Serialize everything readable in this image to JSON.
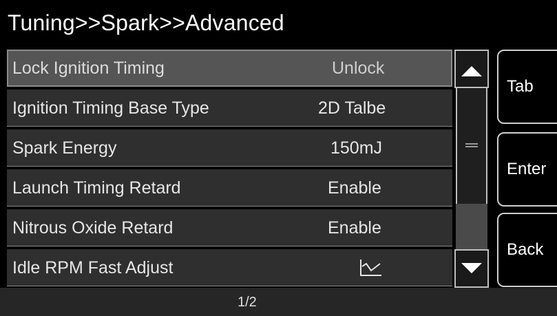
{
  "title": "Tuning>>Spark>>Advanced",
  "rows": [
    {
      "label": "Lock Ignition Timing",
      "value": "Unlock"
    },
    {
      "label": "Ignition Timing Base Type",
      "value": "2D Talbe"
    },
    {
      "label": "Spark Energy",
      "value": "150mJ"
    },
    {
      "label": "Launch Timing Retard",
      "value": "Enable"
    },
    {
      "label": "Nitrous Oxide Retard",
      "value": "Enable"
    },
    {
      "label": "Idle RPM Fast Adjust",
      "value_icon": "line-chart-icon"
    }
  ],
  "buttons": {
    "tab": "Tab",
    "enter": "Enter",
    "back": "Back"
  },
  "pagination": "1/2",
  "scrollbar": {
    "up_icon": "triangle-up-icon",
    "down_icon": "triangle-down-icon"
  }
}
